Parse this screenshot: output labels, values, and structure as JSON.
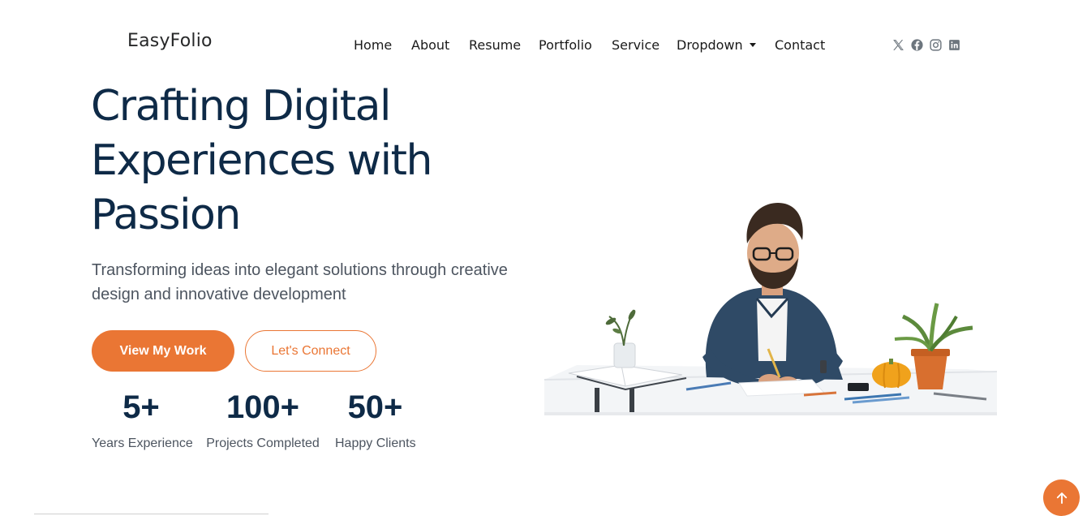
{
  "header": {
    "logo": "EasyFolio",
    "nav": {
      "home": "Home",
      "about": "About",
      "resume": "Resume",
      "portfolio": "Portfolio",
      "service": "Service",
      "dropdown": "Dropdown",
      "contact": "Contact"
    },
    "socials": [
      "x-icon",
      "facebook-icon",
      "instagram-icon",
      "linkedin-icon"
    ]
  },
  "hero": {
    "title": "Crafting Digital Experiences with Passion",
    "subtitle": "Transforming ideas into elegant solutions through creative design and innovative development",
    "primary_button": "View My Work",
    "secondary_button": "Let's Connect",
    "stats": [
      {
        "value": "5+",
        "label": "Years Experience"
      },
      {
        "value": "100+",
        "label": "Projects Completed"
      },
      {
        "value": "50+",
        "label": "Happy Clients"
      }
    ]
  },
  "colors": {
    "accent": "#ea7634",
    "heading": "#0e2a47",
    "text": "#4d5560"
  }
}
